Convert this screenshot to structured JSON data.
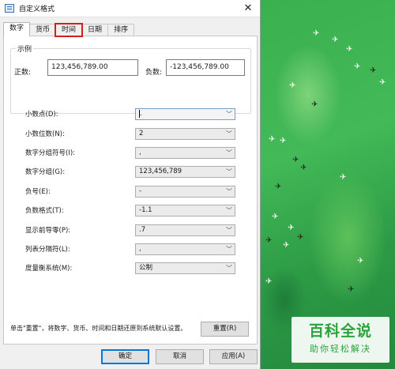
{
  "window": {
    "title": "自定义格式",
    "close_glyph": "✕"
  },
  "tabs": [
    {
      "label": "数字",
      "active": true
    },
    {
      "label": "货币",
      "active": false
    },
    {
      "label": "时间",
      "active": false,
      "highlighted": true
    },
    {
      "label": "日期",
      "active": false
    },
    {
      "label": "排序",
      "active": false
    }
  ],
  "sample": {
    "legend": "示例",
    "positive_label": "正数:",
    "positive_value": "123,456,789.00",
    "negative_label": "负数:",
    "negative_value": "-123,456,789.00"
  },
  "settings": [
    {
      "label": "小数点(D):",
      "value": "."
    },
    {
      "label": "小数位数(N):",
      "value": "2"
    },
    {
      "label": "数字分组符号(I):",
      "value": ","
    },
    {
      "label": "数字分组(G):",
      "value": "123,456,789"
    },
    {
      "label": "负号(E):",
      "value": "-"
    },
    {
      "label": "负数格式(T):",
      "value": "-1.1"
    },
    {
      "label": "显示前导零(P):",
      "value": ".7"
    },
    {
      "label": "列表分隔符(L):",
      "value": ","
    },
    {
      "label": "度量衡系统(M):",
      "value": "公制"
    }
  ],
  "note": "单击\"重置\"，将数字、货币、时间和日期还原到系统默认设置。",
  "buttons": {
    "reset": "重置(R)",
    "ok": "确定",
    "cancel": "取消",
    "apply": "应用(A)"
  },
  "watermark": {
    "main": "百科全说",
    "sub": "助你轻松解决"
  },
  "colors": {
    "tab_highlight": "#d0211c",
    "watermark_green": "#2aa33b",
    "default_button_border": "#0078d7"
  }
}
